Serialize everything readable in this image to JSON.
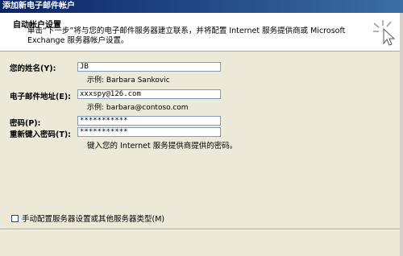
{
  "window": {
    "title": "添加新电子邮件帐户"
  },
  "header": {
    "title": "自动帐户设置",
    "description": "单击“下一步”将与您的电子邮件服务器建立联系，并将配置 Internet 服务提供商或 Microsoft Exchange 服务器帐户设置。"
  },
  "form": {
    "name": {
      "label": "您的姓名(Y):",
      "value": "JB",
      "example": "示例: Barbara Sankovic"
    },
    "email": {
      "label": "电子邮件地址(E):",
      "value": "xxxspy@126.com",
      "example": "示例: barbara@contoso.com"
    },
    "password": {
      "label": "密码(P):",
      "value": "***********"
    },
    "retype": {
      "label": "重新键入密码(T):",
      "value": "***********"
    },
    "password_hint": "键入您的 Internet 服务提供商提供的密码。"
  },
  "manual_config": {
    "label": "手动配置服务器设置或其他服务器类型(M)",
    "checked": false
  },
  "icons": {
    "wizard": "wizard-cursor-icon"
  },
  "colors": {
    "title_bar": "#0a246a",
    "dialog_bg": "#ece9d8",
    "field_border": "#7f9db9"
  }
}
